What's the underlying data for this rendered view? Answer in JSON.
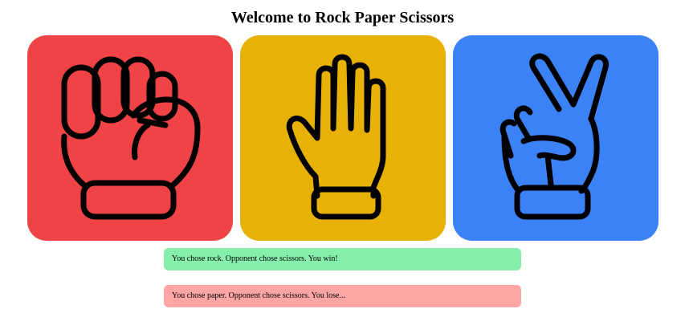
{
  "page": {
    "title": "Welcome to Rock Paper Scissors"
  },
  "choices": [
    {
      "id": "rock",
      "icon": "fist-icon",
      "color": "#ef4346"
    },
    {
      "id": "paper",
      "icon": "open-hand-icon",
      "color": "#e8b106"
    },
    {
      "id": "scissors",
      "icon": "peace-hand-icon",
      "color": "#3b82f6"
    }
  ],
  "results": [
    {
      "text": "You chose rock. Opponent chose scissors. You win!",
      "outcome": "win",
      "color": "#86efac"
    },
    {
      "text": "You chose paper. Opponent chose scissors. You lose...",
      "outcome": "lose",
      "color": "#fca5a5"
    }
  ]
}
